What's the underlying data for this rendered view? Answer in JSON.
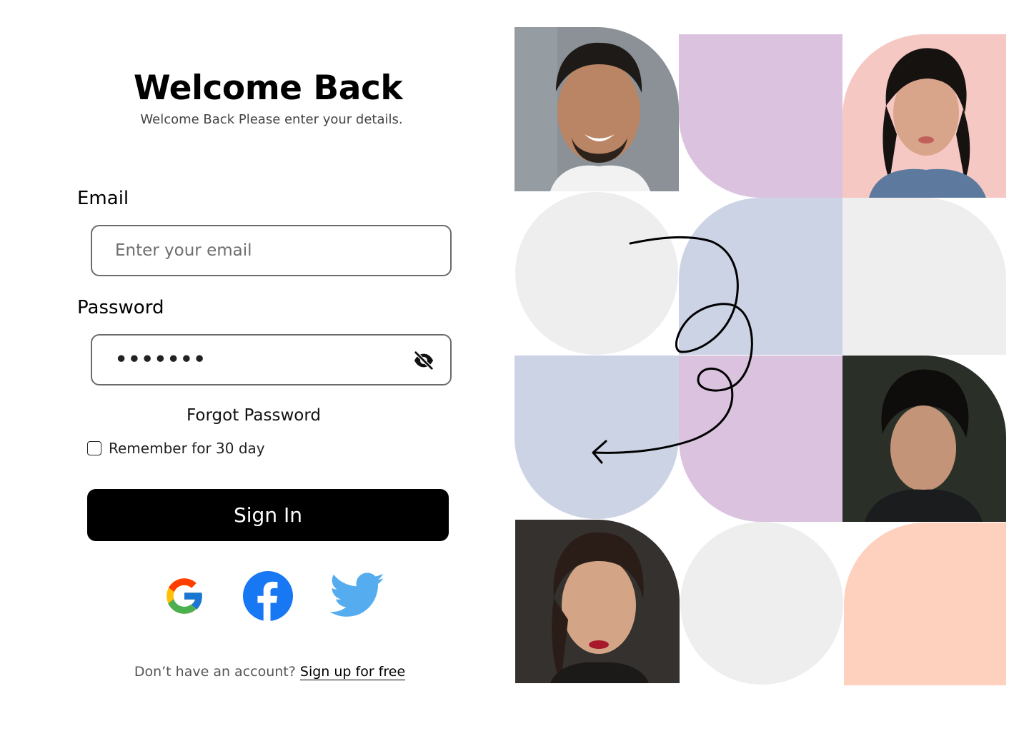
{
  "header": {
    "title": "Welcome Back",
    "subtitle": "Welcome Back Please enter your details."
  },
  "form": {
    "email_label": "Email",
    "email_placeholder": "Enter your email",
    "password_label": "Password",
    "password_mask": "•••••••",
    "forgot_label": "Forgot Password",
    "remember_label": "Remember for 30 day",
    "signin_label": "Sign In"
  },
  "social": [
    {
      "name": "google",
      "icon": "google-icon"
    },
    {
      "name": "facebook",
      "icon": "facebook-icon"
    },
    {
      "name": "twitter",
      "icon": "twitter-icon"
    }
  ],
  "footer": {
    "prompt": "Don’t have an account?",
    "link": "Sign up for free"
  },
  "colors": {
    "button_bg": "#000000",
    "lavender": "#dbc3e0",
    "periwinkle": "#cbd3e5",
    "light_gray": "#eeeeee",
    "peach": "#fdd1bd",
    "facebook_blue": "#1877f2",
    "twitter_blue": "#55acee"
  }
}
